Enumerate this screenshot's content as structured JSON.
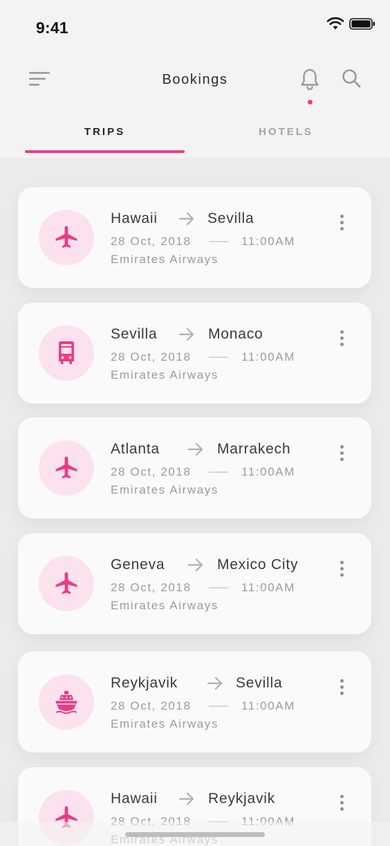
{
  "status_bar": {
    "time": "9:41"
  },
  "header": {
    "title": "Bookings"
  },
  "tabs": [
    {
      "label": "TRIPS",
      "active": true
    },
    {
      "label": "HOTELS",
      "active": false
    }
  ],
  "colors": {
    "accent": "#ec3b86",
    "accent_light": "#fbe2ee",
    "background": "#ebebeb",
    "card": "#fafafa"
  },
  "trips": [
    {
      "icon": "airplane-icon",
      "from": "Hawaii",
      "to": "Sevilla",
      "date": "28 Oct, 2018",
      "time": "11:00AM",
      "airline": "Emirates Airways"
    },
    {
      "icon": "bus-icon",
      "from": "Sevilla",
      "to": "Monaco",
      "date": "28 Oct, 2018",
      "time": "11:00AM",
      "airline": "Emirates Airways"
    },
    {
      "icon": "airplane-icon",
      "from": "Atlanta",
      "to": "Marrakech",
      "date": "28 Oct, 2018",
      "time": "11:00AM",
      "airline": "Emirates Airways"
    },
    {
      "icon": "airplane-icon",
      "from": "Geneva",
      "to": "Mexico City",
      "date": "28 Oct, 2018",
      "time": "11:00AM",
      "airline": "Emirates Airways"
    },
    {
      "icon": "ship-icon",
      "from": "Reykjavik",
      "to": "Sevilla",
      "date": "28 Oct, 2018",
      "time": "11:00AM",
      "airline": "Emirates Airways"
    },
    {
      "icon": "airplane-icon",
      "from": "Hawaii",
      "to": "Reykjavik",
      "date": "28 Oct, 2018",
      "time": "11:00AM",
      "airline": "Emirates Airways"
    }
  ]
}
